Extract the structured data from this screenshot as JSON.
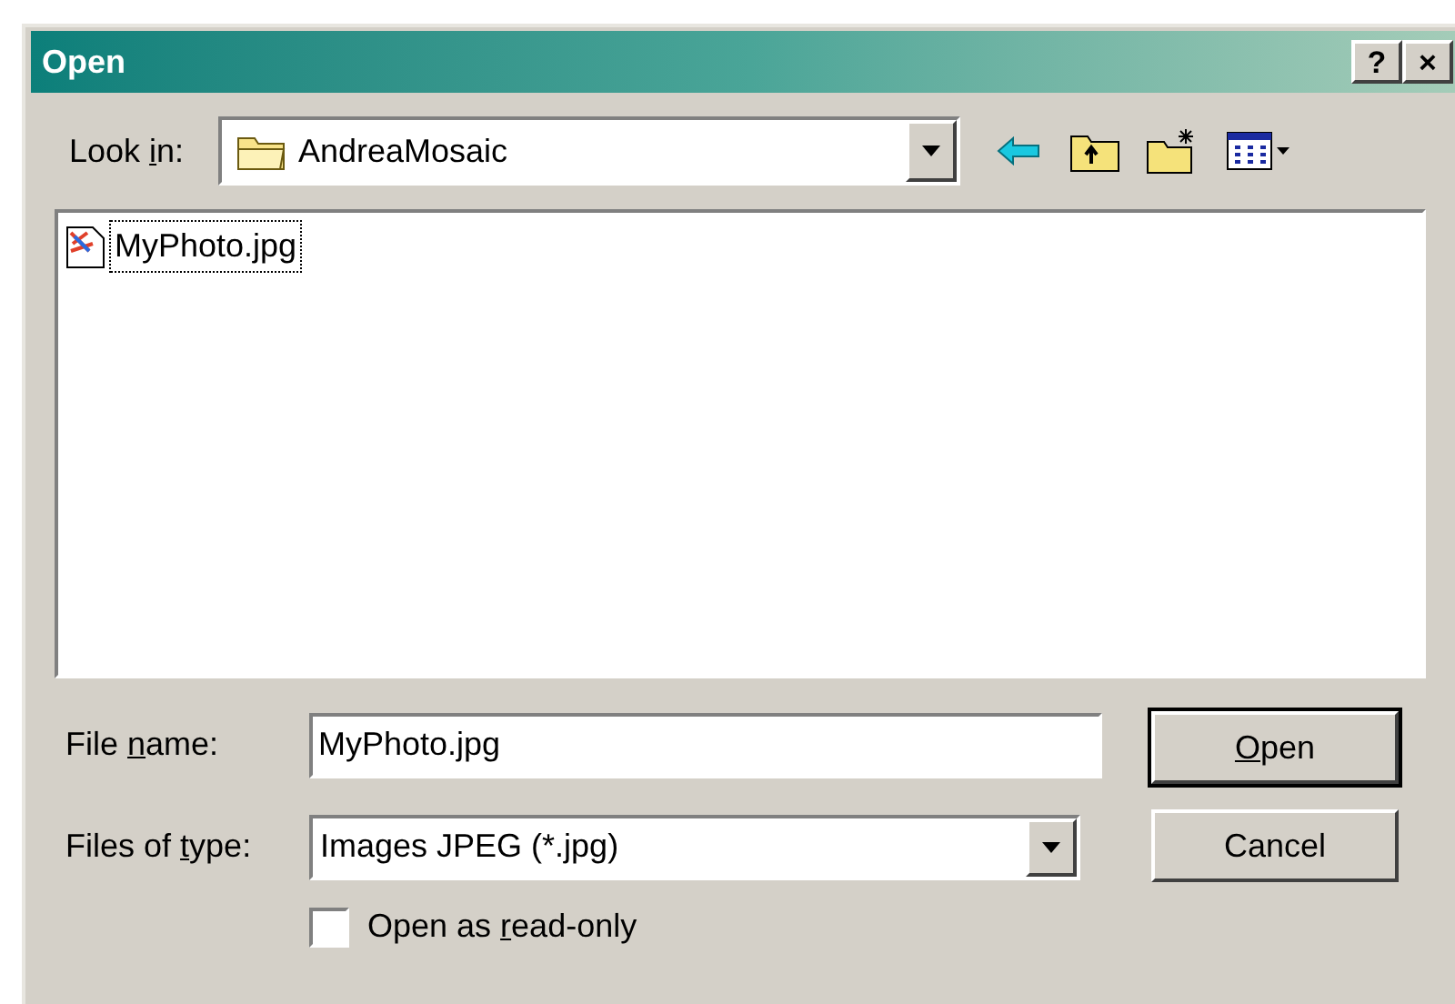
{
  "window": {
    "title": "Open",
    "buttons": [
      "?",
      "×"
    ]
  },
  "look_in": {
    "label_parts": [
      "Look ",
      "i",
      "n:"
    ],
    "value": "AndreaMosaic"
  },
  "files": [
    {
      "name": "MyPhoto.jpg",
      "selected": true
    }
  ],
  "file_name": {
    "label_parts": [
      "File ",
      "n",
      "ame:"
    ],
    "value": "MyPhoto.jpg"
  },
  "file_type": {
    "label_parts": [
      "Files of ",
      "t",
      "ype:"
    ],
    "value": "Images JPEG (*.jpg)"
  },
  "read_only": {
    "label_parts": [
      "Open as ",
      "r",
      "ead-only"
    ],
    "checked": false
  },
  "buttons": [
    {
      "label_parts": {
        "key": "O",
        "after": "pen"
      },
      "default": true
    },
    {
      "label_parts": {
        "before": "Cancel"
      },
      "default": false
    }
  ]
}
